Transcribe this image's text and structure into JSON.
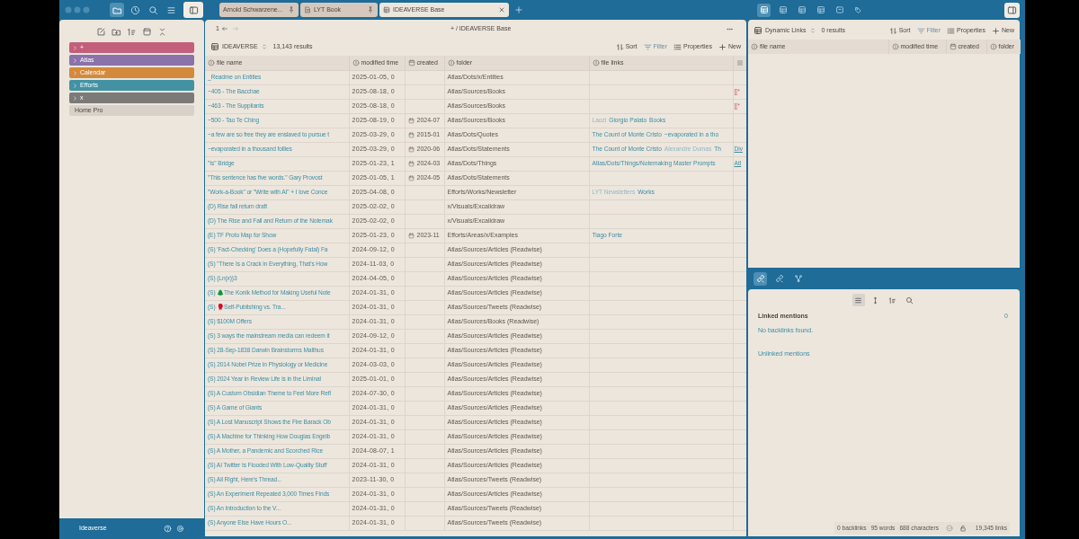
{
  "ribbon": [
    {
      "selected": true
    },
    {
      "selected": false
    },
    {
      "selected": false
    },
    {
      "selected": false
    }
  ],
  "tabs": [
    {
      "label": "Arnold Schwarzene...",
      "kind": "note",
      "selected": false,
      "pinned": true
    },
    {
      "label": "LYT Book",
      "kind": "page",
      "selected": false,
      "pinned": true
    },
    {
      "label": "IDEAVERSE Base",
      "kind": "base",
      "selected": true,
      "pinned": false
    }
  ],
  "view_switcher": [
    {
      "selected": true
    },
    {
      "selected": false
    },
    {
      "selected": false
    },
    {
      "selected": false
    },
    {
      "selected": false
    },
    {
      "selected": false
    }
  ],
  "sidebar": {
    "items": [
      {
        "label": "+",
        "kind": "folder",
        "color": "#c25f7b"
      },
      {
        "label": "Atlas",
        "kind": "folder",
        "color": "#8b72aa"
      },
      {
        "label": "Calendar",
        "kind": "folder",
        "color": "#d38a3c"
      },
      {
        "label": "Efforts",
        "kind": "folder",
        "color": "#4292a4"
      },
      {
        "label": "x",
        "kind": "folder",
        "color": "#7b7a78"
      },
      {
        "label": "Home Pro",
        "kind": "file"
      }
    ],
    "vault": "Ideaverse"
  },
  "main": {
    "history": "1",
    "breadcrumb": "+ / IDEAVERSE Base",
    "view": "IDEAVERSE",
    "count": "13,143 results",
    "actions": [
      "Sort",
      "Filter",
      "Properties",
      "New"
    ],
    "columns": [
      {
        "label": "file name",
        "kind": "text"
      },
      {
        "label": "modified time",
        "kind": "text"
      },
      {
        "label": "created",
        "kind": "date"
      },
      {
        "label": "folder",
        "kind": "text"
      },
      {
        "label": "file links",
        "kind": "text"
      },
      {
        "kind": "list"
      }
    ],
    "rows": [
      {
        "name": "_Readme on Entities",
        "modified": "2025-01-05, 0",
        "folder": "Atlas/Dots/x/Entities"
      },
      {
        "name": "~405 - The Bacchae",
        "modified": "2025-08-18, 0",
        "folder": "Atlas/Sources/Books",
        "extra": {
          "text": "[[*",
          "kind": "broken"
        }
      },
      {
        "name": "~463 - The Suppliants",
        "modified": "2025-08-18, 0",
        "folder": "Atlas/Sources/Books",
        "extra": {
          "text": "[[*",
          "kind": "broken"
        }
      },
      {
        "name": "~500 - Tao Te Ching",
        "modified": "2025-08-19, 0",
        "created": "2024-07",
        "folder": "Atlas/Sources/Books",
        "links": [
          {
            "text": "Laozi",
            "muted": true
          },
          {
            "text": "Giorgio Palato",
            "muted": false
          },
          {
            "text": "Books",
            "muted": false
          }
        ]
      },
      {
        "name": "~a few are so free they are enslaved to pursue t",
        "modified": "2025-03-29, 0",
        "created": "2015-01",
        "folder": "Atlas/Dots/Quotes",
        "links": [
          {
            "text": "The Count of Monte Cristo",
            "muted": false
          },
          {
            "text": "~evaporated in a tho",
            "muted": false
          }
        ]
      },
      {
        "name": "~evaporated in a thousand follies",
        "modified": "2025-03-29, 0",
        "created": "2020-06",
        "folder": "Atlas/Dots/Statements",
        "links": [
          {
            "text": "The Count of Monte Cristo",
            "muted": false
          },
          {
            "text": "Alexandre Dumas",
            "muted": true
          },
          {
            "text": "Th",
            "muted": false
          }
        ],
        "extra": {
          "text": "Div",
          "kind": "link"
        }
      },
      {
        "name": "\"Is\" Bridge",
        "modified": "2025-01-23, 1",
        "created": "2024-03",
        "folder": "Atlas/Dots/Things",
        "links": [
          {
            "text": "Atlas/Dots/Things/Notemaking Master Prompts",
            "muted": false
          }
        ],
        "extra": {
          "text": "Atl",
          "kind": "link"
        }
      },
      {
        "name": "\"This sentence has five words.\" Gary Provost",
        "modified": "2025-01-05, 1",
        "created": "2024-05",
        "folder": "Atlas/Dots/Statements"
      },
      {
        "name": "\"Work-a-Book\" or \"Write with AI\" + I love Conce",
        "modified": "2025-04-08, 0",
        "folder": "Efforts/Works/Newsletter",
        "links": [
          {
            "text": "LYT Newsletters",
            "muted": true
          },
          {
            "text": "Works",
            "muted": false
          }
        ]
      },
      {
        "name": "(D) Rise fall return draft",
        "modified": "2025-02-02, 0",
        "folder": "x/Visuals/Excalidraw"
      },
      {
        "name": "(D) The Rise and Fall and Return of the Notemak",
        "modified": "2025-02-02, 0",
        "folder": "x/Visuals/Excalidraw"
      },
      {
        "name": "(E) TF Proto Map for Show",
        "modified": "2025-01-23, 0",
        "created": "2023-11",
        "folder": "Efforts/Areas/x/Examples",
        "links": [
          {
            "text": "Tiago Forte",
            "muted": false
          }
        ]
      },
      {
        "name": "(S) 'Fact-Checking' Does a (Hopefully Fatal) Fa",
        "modified": "2024-09-12, 0",
        "folder": "Atlas/Sources/Articles (Readwise)"
      },
      {
        "name": "(S) \"There Is a Crack in Everything, That's How",
        "modified": "2024-11-03, 0",
        "folder": "Atlas/Sources/Articles (Readwise)"
      },
      {
        "name": "(S) (Ln(x))3",
        "modified": "2024-04-05, 0",
        "folder": "Atlas/Sources/Articles (Readwise)"
      },
      {
        "name": "(S) 🌲The Konik Method for Making Useful Note",
        "modified": "2024-01-31, 0",
        "folder": "Atlas/Sources/Articles (Readwise)"
      },
      {
        "name": "(S) 🥊Self-Publishing vs. Tra...",
        "modified": "2024-01-31, 0",
        "folder": "Atlas/Sources/Tweets (Readwise)"
      },
      {
        "name": "(S) $100M Offers",
        "modified": "2024-01-31, 0",
        "folder": "Atlas/Sources/Books (Readwise)"
      },
      {
        "name": "(S) 3 ways the mainstream media can redeem it",
        "modified": "2024-09-12, 0",
        "folder": "Atlas/Sources/Articles (Readwise)"
      },
      {
        "name": "(S) 28-Sep-1838 Darwin Brainstorms Malthus",
        "modified": "2024-01-31, 0",
        "folder": "Atlas/Sources/Articles (Readwise)"
      },
      {
        "name": "(S) 2014 Nobel Prize in Physiology or Medicine",
        "modified": "2024-03-03, 0",
        "folder": "Atlas/Sources/Articles (Readwise)"
      },
      {
        "name": "(S) 2024 Year in Review Life is in the Liminal",
        "modified": "2025-01-01, 0",
        "folder": "Atlas/Sources/Articles (Readwise)"
      },
      {
        "name": "(S) A Custom Obsidian Theme to Feel More Refl",
        "modified": "2024-07-30, 0",
        "folder": "Atlas/Sources/Articles (Readwise)"
      },
      {
        "name": "(S) A Game of Giants",
        "modified": "2024-01-31, 0",
        "folder": "Atlas/Sources/Articles (Readwise)"
      },
      {
        "name": "(S) A Lost Manuscript Shows the Fire Barack Ob",
        "modified": "2024-01-31, 0",
        "folder": "Atlas/Sources/Articles (Readwise)"
      },
      {
        "name": "(S) A Machine for Thinking How Douglas Engelb",
        "modified": "2024-01-31, 0",
        "folder": "Atlas/Sources/Articles (Readwise)"
      },
      {
        "name": "(S) A Mother, a Pandemic and Scorched Rice",
        "modified": "2024-08-07, 1",
        "folder": "Atlas/Sources/Articles (Readwise)"
      },
      {
        "name": "(S) AI Twitter Is Flooded With Low-Quality Stuff",
        "modified": "2024-01-31, 0",
        "folder": "Atlas/Sources/Articles (Readwise)"
      },
      {
        "name": "(S) All Right, Here's Thread...",
        "modified": "2023-11-30, 0",
        "folder": "Atlas/Sources/Tweets (Readwise)"
      },
      {
        "name": "(S) An Experiment Repeated 3,000 Times Finds",
        "modified": "2024-01-31, 0",
        "folder": "Atlas/Sources/Articles (Readwise)"
      },
      {
        "name": "(S) An Introduction to the V...",
        "modified": "2024-01-31, 0",
        "folder": "Atlas/Sources/Tweets (Readwise)"
      },
      {
        "name": "(S) Anyone Else Have Hours O...",
        "modified": "2024-01-31, 0",
        "folder": "Atlas/Sources/Tweets (Readwise)"
      }
    ]
  },
  "dynamic_links": {
    "view": "Dynamic Links",
    "count": "0 results",
    "actions": [
      "Sort",
      "Filter",
      "Properties",
      "New"
    ],
    "columns": [
      {
        "label": "file name",
        "kind": "text"
      },
      {
        "label": "modified time",
        "kind": "text"
      },
      {
        "label": "created",
        "kind": "date"
      },
      {
        "label": "folder",
        "kind": "text"
      }
    ]
  },
  "backlinks": {
    "panel_tabs": [
      {
        "selected": true
      },
      {
        "selected": false
      },
      {
        "selected": false
      }
    ],
    "tools": [
      {
        "selected": true
      },
      {
        "selected": false
      },
      {
        "selected": false
      },
      {
        "selected": false
      }
    ],
    "linked_title": "Linked mentions",
    "linked_count": "0",
    "empty": "No backlinks found.",
    "unlinked": "Unlinked mentions"
  },
  "status_bar": {
    "stats": [
      "0 backlinks",
      "95 words",
      "688 characters"
    ],
    "links": "19,345 links"
  }
}
